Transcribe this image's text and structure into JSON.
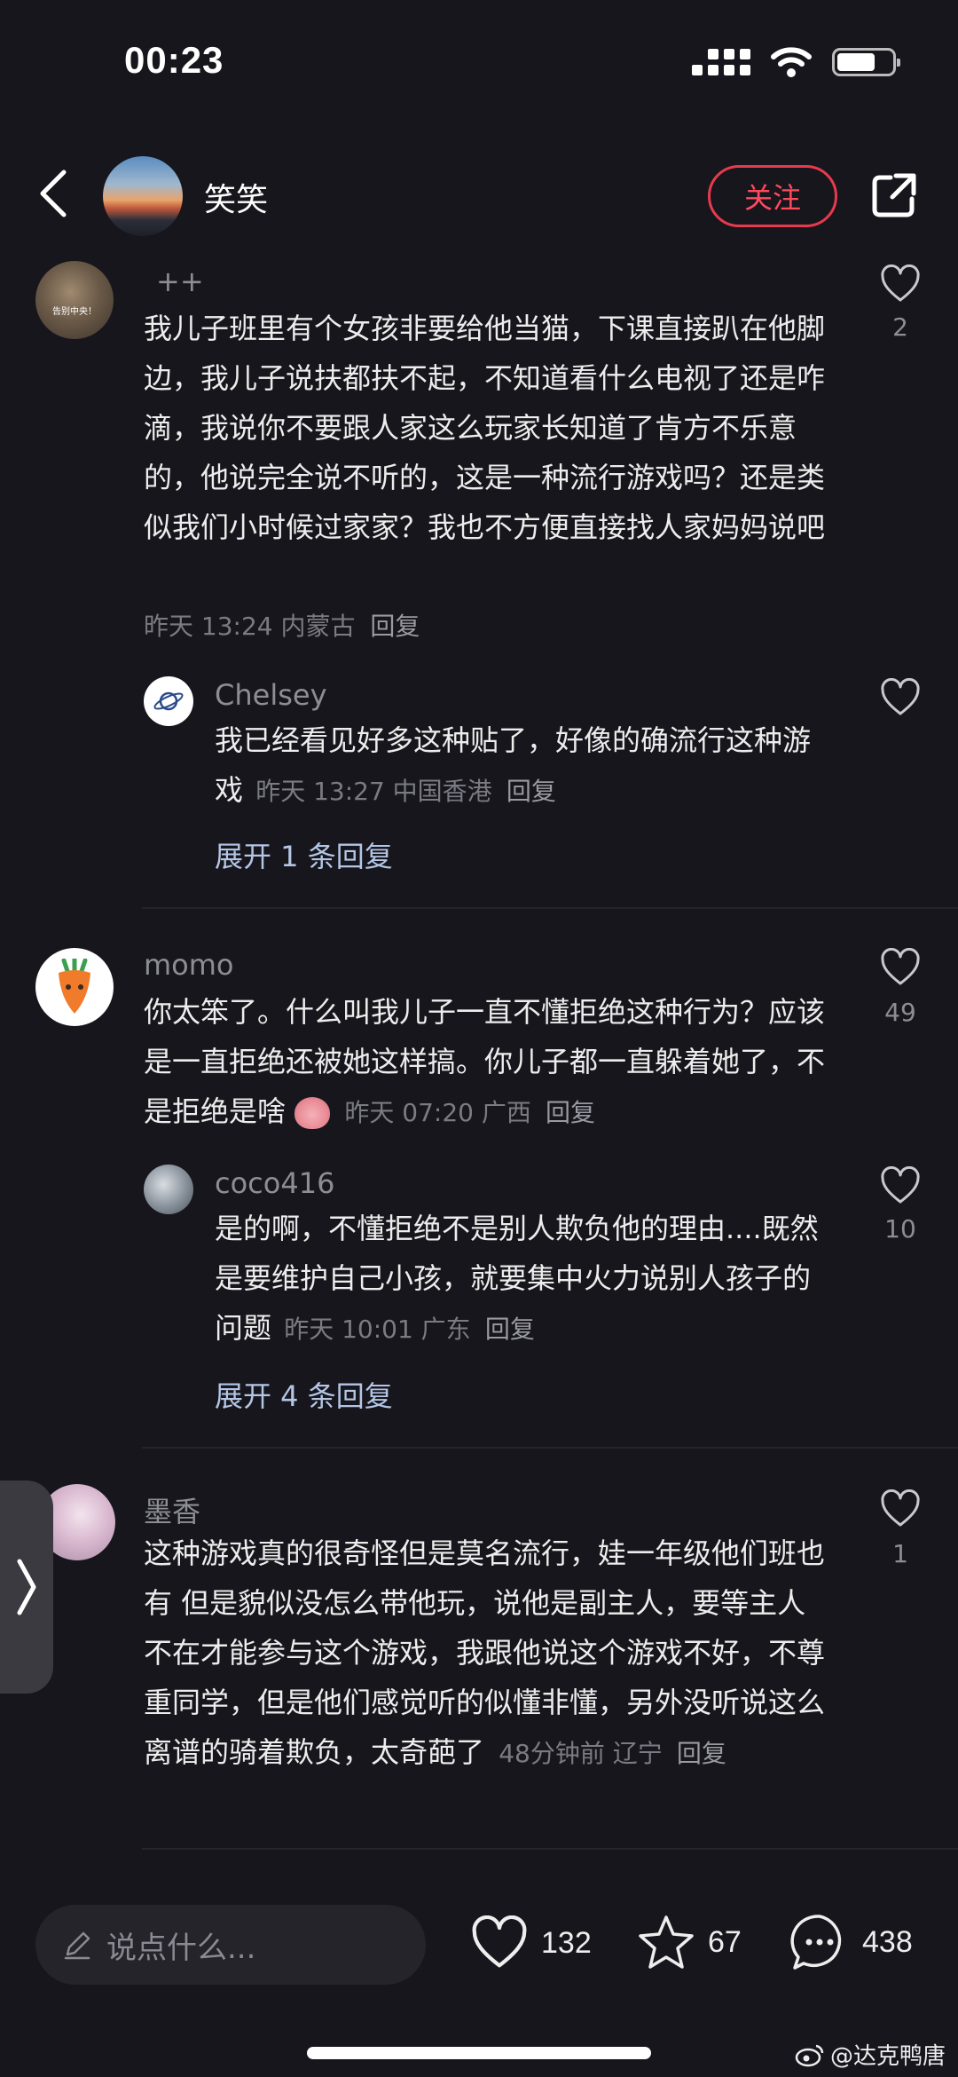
{
  "status_bar": {
    "time": "00:23"
  },
  "header": {
    "username": "笑笑",
    "follow_label": "关注"
  },
  "comments": [
    {
      "username": "++",
      "text": "我儿子班里有个女孩非要给他当猫，下课直接趴在他脚边，我儿子说扶都扶不起，不知道看什么电视了还是咋滴，我说你不要跟人家这么玩家长知道了肯方不乐意的，他说完全说不听的，这是一种流行游戏吗？还是类似我们小时候过家家？我也不方便直接找人家妈妈说吧",
      "meta": "昨天 13:24 内蒙古",
      "reply": "回复",
      "likes": "2",
      "avatar_caption": "告别中央！",
      "replies": [
        {
          "username": "Chelsey",
          "text": "我已经看见好多这种贴了，好像的确流行这种游戏",
          "meta": "昨天 13:27 中国香港",
          "reply": "回复",
          "likes": ""
        }
      ],
      "expand": "展开 1 条回复"
    },
    {
      "username": "momo",
      "text": "你太笨了。什么叫我儿子一直不懂拒绝这种行为？应该是一直拒绝还被她这样搞。你儿子都一直躲着她了，不是拒绝是啥",
      "meta": "昨天 07:20 广西",
      "reply": "回复",
      "likes": "49",
      "replies": [
        {
          "username": "coco416",
          "text": "是的啊，不懂拒绝不是别人欺负他的理由....既然是要维护自己小孩，就要集中火力说别人孩子的问题",
          "meta": "昨天 10:01 广东",
          "reply": "回复",
          "likes": "10"
        }
      ],
      "expand": "展开 4 条回复"
    },
    {
      "username": "墨香",
      "text": "这种游戏真的很奇怪但是莫名流行，娃一年级他们班也有 但是貌似没怎么带他玩，说他是副主人，要等主人不在才能参与这个游戏，我跟他说这个游戏不好，不尊重同学，但是他们感觉听的似懂非懂，另外没听说这么离谱的骑着欺负，太奇葩了",
      "meta": "48分钟前 辽宁",
      "reply": "回复",
      "likes": "1"
    }
  ],
  "bottom_bar": {
    "input_placeholder": "说点什么...",
    "likes": "132",
    "favorites": "67",
    "comments": "438"
  },
  "watermark": "@达克鸭唐",
  "colors": {
    "background": "#17161c",
    "accent": "#e83a4e",
    "link": "#b4c6e6"
  }
}
